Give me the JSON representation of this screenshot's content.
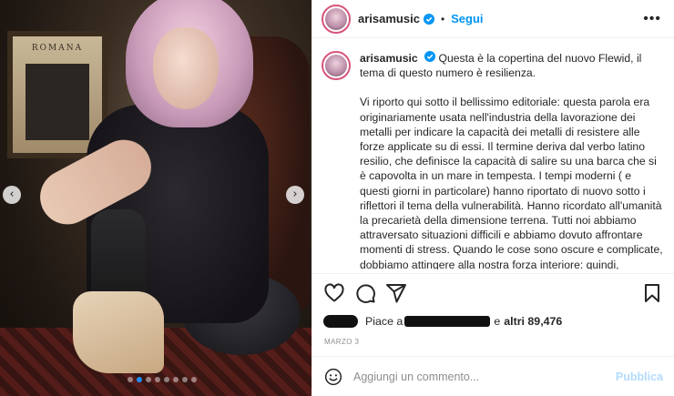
{
  "post": {
    "username": "arisamusic",
    "follow_label": "Segui",
    "more_label": "•••",
    "separator": "•"
  },
  "photo": {
    "frame_text": "ROMANA",
    "prev_label": "‹",
    "next_label": "›",
    "slides_count": 8,
    "active_slide": 1
  },
  "caption": {
    "username": "arisamusic",
    "intro": "Questa è la copertina del nuovo Flewid, il tema di questo numero è resilienza.",
    "body": "Vi riporto qui sotto il bellissimo editoriale: questa parola era originariamente usata nell'industria della lavorazione dei metalli per indicare la capacità dei metalli di resistere alle forze applicate su di essi. Il termine deriva dal verbo latino resilio, che definisce la capacità di salire su una barca che si è capovolta in un mare in tempesta. I tempi moderni ( e questi giorni in particolare) hanno riportato di nuovo sotto i riflettori il tema della vulnerabilità. Hanno ricordato all'umanità la precarietà della dimensione terrena. Tutti noi abbiamo attraversato situazioni difficili e abbiamo dovuto affrontare momenti di stress. Quando le cose sono oscure e complicate, dobbiamo attingere alla nostra forza interiore: quindi, potremmo pensare alla resilienza come alla capacità di un individuo di emergere da eventi traumatici più forte di prima. Essere in grado di superare quell'evento aumenta"
  },
  "likes": {
    "prefix": "Piace a",
    "middle": "e",
    "others": "altri 89,476"
  },
  "date": "MARZO 3",
  "comment": {
    "placeholder": "Aggiungi un commento...",
    "publish_label": "Pubblica"
  },
  "colors": {
    "accent": "#0095f6",
    "story_ring": "#d8537a",
    "publish_disabled": "#b3dbff"
  }
}
